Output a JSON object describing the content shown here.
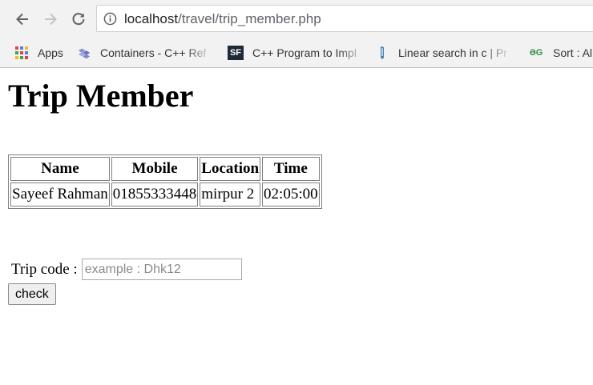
{
  "browser": {
    "url_host": "localhost",
    "url_path": "/travel/trip_member.php",
    "bookmarks": [
      {
        "label": "Apps",
        "icon": "apps-grid-icon"
      },
      {
        "label": "Containers - C++ Ref",
        "icon": "containers-icon"
      },
      {
        "label": "C++ Program to Impl",
        "icon": "sf-icon"
      },
      {
        "label": "Linear search in c | Pr",
        "icon": "bookmark-icon"
      },
      {
        "label": "Sort : Al",
        "icon": "gfg-icon"
      }
    ],
    "sf_icon_text": "SF",
    "gfg_icon_text": "ƏG"
  },
  "page": {
    "title": "Trip Member",
    "table": {
      "headers": [
        "Name",
        "Mobile",
        "Location",
        "Time"
      ],
      "rows": [
        [
          "Sayeef Rahman",
          "01855333448",
          "mirpur 2",
          "02:05:00"
        ]
      ]
    },
    "form": {
      "label": "Trip code :",
      "placeholder": "example : Dhk12",
      "value": "",
      "button_label": "check"
    }
  }
}
